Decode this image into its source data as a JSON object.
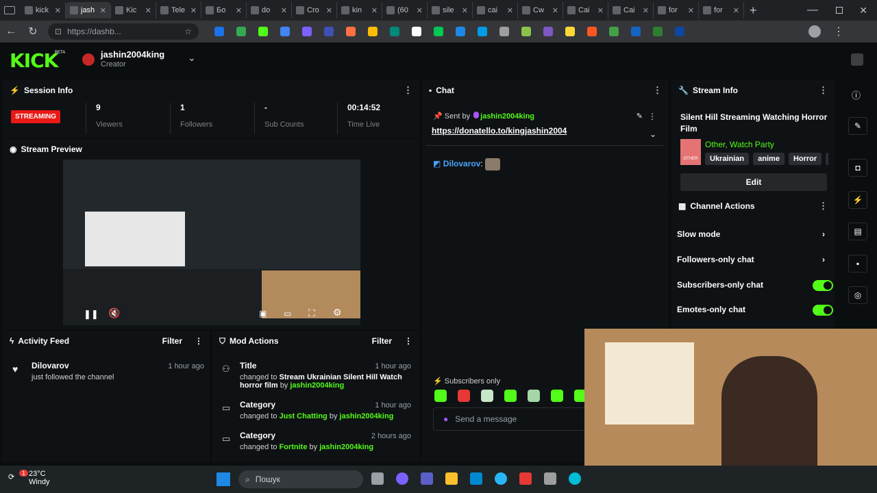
{
  "browser": {
    "tabs": [
      {
        "label": "kick"
      },
      {
        "label": "jash"
      },
      {
        "label": "Kic"
      },
      {
        "label": "Tele"
      },
      {
        "label": "Бо"
      },
      {
        "label": "do"
      },
      {
        "label": "Cro"
      },
      {
        "label": "kin"
      },
      {
        "label": "(60"
      },
      {
        "label": "sile"
      },
      {
        "label": "cai"
      },
      {
        "label": "Cw"
      },
      {
        "label": "Cai"
      },
      {
        "label": "Cai"
      },
      {
        "label": "for"
      },
      {
        "label": "for"
      }
    ],
    "url": "https://dashb..."
  },
  "header": {
    "logo": "KICK",
    "beta": "BETA",
    "username": "jashin2004king",
    "role": "Creator"
  },
  "session": {
    "title": "Session Info",
    "status": "STREAMING",
    "stats": [
      {
        "value": "9",
        "label": "Viewers"
      },
      {
        "value": "1",
        "label": "Followers"
      },
      {
        "value": "-",
        "label": "Sub Counts"
      },
      {
        "value": "00:14:52",
        "label": "Time Live"
      }
    ]
  },
  "preview": {
    "title": "Stream Preview"
  },
  "activity": {
    "title": "Activity Feed",
    "filter": "Filter",
    "items": [
      {
        "user": "Dilovarov",
        "text": "just followed the channel",
        "time": "1 hour ago"
      }
    ]
  },
  "mod": {
    "title": "Mod Actions",
    "filter": "Filter",
    "items": [
      {
        "title": "Title",
        "prefix": "changed to",
        "target": "Stream Ukrainian Silent Hill Watch horror film",
        "by": "by",
        "user": "jashin2004king",
        "time": "1 hour ago"
      },
      {
        "title": "Category",
        "prefix": "changed to",
        "target": "Just Chatting",
        "by": "by",
        "user": "jashin2004king",
        "time": "1 hour ago"
      },
      {
        "title": "Category",
        "prefix": "changed to",
        "target": "Fortnite",
        "by": "by",
        "user": "jashin2004king",
        "time": "2 hours ago"
      }
    ]
  },
  "chat": {
    "title": "Chat",
    "pinned_by_prefix": "Sent by",
    "pinned_user": "jashin2004king",
    "pinned_link": "https://donatello.to/kingjashin2004",
    "message_user": "Dilovarov",
    "subscribers_only": "Subscribers only",
    "placeholder": "Send a message"
  },
  "stream_info": {
    "title": "Stream Info",
    "stream_title": "Silent Hill Streaming Watching Horror Film",
    "category": "Other, Watch Party",
    "category_thumb": "OTHER",
    "tags": [
      "Ukrainian",
      "anime",
      "Horror",
      "fi"
    ],
    "edit": "Edit"
  },
  "channel_actions": {
    "title": "Channel Actions",
    "items": [
      {
        "label": "Slow mode",
        "kind": "arrow"
      },
      {
        "label": "Followers-only chat",
        "kind": "arrow"
      },
      {
        "label": "Subscribers-only chat",
        "kind": "toggle"
      },
      {
        "label": "Emotes-only chat",
        "kind": "toggle"
      }
    ]
  },
  "taskbar": {
    "temp": "23°C",
    "weather": "Windy",
    "badge": "1",
    "search": "Пошук"
  },
  "colors": {
    "accent": "#53fc18",
    "streaming": "#e91916"
  }
}
